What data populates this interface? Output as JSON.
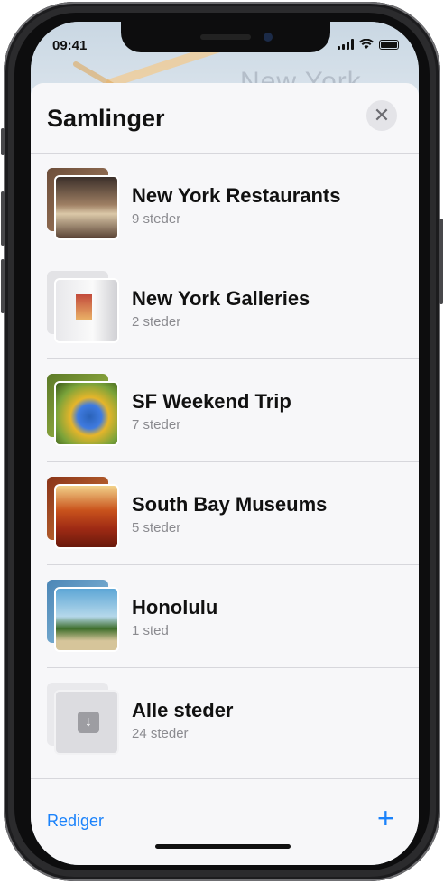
{
  "status_bar": {
    "time": "09:41"
  },
  "map": {
    "label": "New York"
  },
  "sheet": {
    "title": "Samlinger",
    "close_glyph": "✕",
    "edit_label": "Rediger",
    "add_glyph": "+",
    "collections": [
      {
        "title": "New York Restaurants",
        "subtitle": "9 steder",
        "thumbnail": "restaurant-photo"
      },
      {
        "title": "New York Galleries",
        "subtitle": "2 steder",
        "thumbnail": "gallery-photo"
      },
      {
        "title": "SF Weekend Trip",
        "subtitle": "7 steder",
        "thumbnail": "parrot-photo"
      },
      {
        "title": "South Bay Museums",
        "subtitle": "5 steder",
        "thumbnail": "theater-photo"
      },
      {
        "title": "Honolulu",
        "subtitle": "1 sted",
        "thumbnail": "beach-photo"
      },
      {
        "title": "Alle steder",
        "subtitle": "24 steder",
        "thumbnail": "download-icon"
      }
    ]
  },
  "colors": {
    "accent": "#1a82fb",
    "sheet_bg": "#f7f7f9",
    "separator": "#d7d7dc"
  }
}
